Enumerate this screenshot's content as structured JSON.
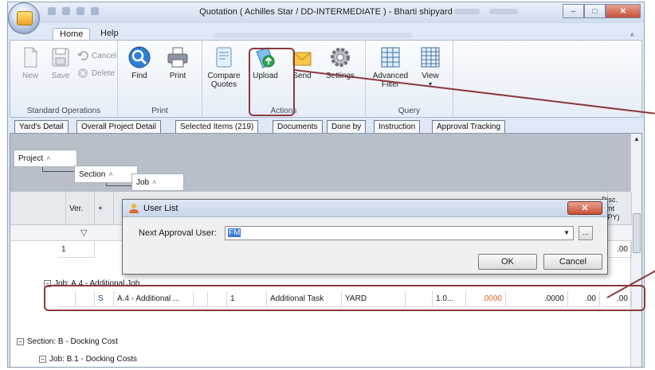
{
  "window": {
    "title": "Quotation ( Achilles Star / DD-INTERMEDIATE ) - Bharti shipyard",
    "controls": [
      "minimize",
      "maximize",
      "close"
    ]
  },
  "ribbon_tabs": [
    {
      "label": "Home",
      "active": true
    },
    {
      "label": "Help",
      "active": false
    }
  ],
  "ribbon": {
    "groups": {
      "standard": {
        "label": "Standard Operations",
        "new": "New",
        "save": "Save",
        "cancel": "Cancel",
        "delete": "Delete"
      },
      "print": {
        "label": "Print",
        "find": "Find",
        "print": "Print"
      },
      "actions": {
        "label": "Actions",
        "compare": "Compare Quotes",
        "upload": "Upload",
        "send": "Send",
        "settings": "Settings"
      },
      "query": {
        "label": "Query",
        "advanced_filter": "Advanced Filter",
        "view": "View"
      }
    }
  },
  "content_tabs": [
    {
      "label": "Yard's Detail",
      "active": false
    },
    {
      "label": "Overall Project Detail",
      "active": false
    },
    {
      "label": "Selected Items (219)",
      "active": true
    },
    {
      "label": "Documents",
      "active": false
    },
    {
      "label": "Done by",
      "active": false
    },
    {
      "label": "Instruction",
      "active": false
    },
    {
      "label": "Approval Tracking",
      "active": false
    }
  ],
  "grid": {
    "group_by": {
      "project": "Project",
      "section": "Section",
      "job": "Job"
    },
    "headers": {
      "ver": "Ver.",
      "plus": "+",
      "disc_amt": "Disc. Amt (JPY)"
    },
    "rows": {
      "first_row_num": "1",
      "first_row_amt": ".00",
      "job_a4": "Job: A.4 - Additional Job",
      "task_row": {
        "type": "S",
        "name": "A.4 - Additional ...",
        "qty": "1",
        "task": "Additional Task",
        "by": "YARD",
        "val1": "1.0...",
        "rate": ".0000",
        "amt": ".0000",
        "disc": ".00",
        "total": ".00"
      },
      "section_b": "Section: B - Docking Cost",
      "job_b1": "Job: B.1 - Docking Costs"
    }
  },
  "dialog": {
    "title": "User List",
    "label": "Next Approval User:",
    "value": "FM",
    "ellipsis": "...",
    "ok": "OK",
    "cancel": "Cancel"
  }
}
